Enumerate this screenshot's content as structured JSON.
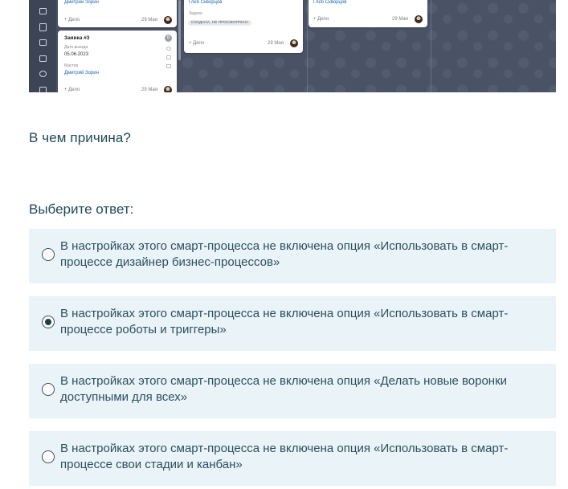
{
  "kanban": {
    "card1": {
      "person": "Дмитрий Зорин",
      "add": "+ Дело",
      "date": "29 Мая"
    },
    "card2": {
      "title": "Заявка #3",
      "badge": "0",
      "date_label": "Дата выезда",
      "date_value": "05.06.2023",
      "master_label": "Мастер",
      "master": "Дмитрий Зорин",
      "add": "+ Дело",
      "date": "29 Мая"
    },
    "card3": {
      "person": "Глеб Скворцов",
      "task_label": "Задача",
      "status_tag": "СОЗДАНА, НЕ ПРОСМОТРЕНА",
      "add": "+ Дело",
      "date": "29 Мая"
    },
    "card4": {
      "person": "Глеб Скворцов",
      "add": "+ Дело",
      "date": "29 Мая"
    }
  },
  "question": "В чем причина?",
  "prompt": "Выберите ответ:",
  "options": [
    {
      "text": "В настройках этого смарт-процесса не включена опция «Использовать в смарт-процессе дизайнер бизнес-процессов»",
      "selected": false
    },
    {
      "text": "В настройках этого смарт-процесса не включена опция «Использовать в смарт-процессе роботы и триггеры»",
      "selected": true
    },
    {
      "text": "В настройках этого смарт-процесса не включена опция «Делать новые воронки доступными для всех»",
      "selected": false
    },
    {
      "text": "В настройках этого смарт-процесса не включена опция «Использовать в смарт-процессе свои стадии и канбан»",
      "selected": false
    }
  ]
}
